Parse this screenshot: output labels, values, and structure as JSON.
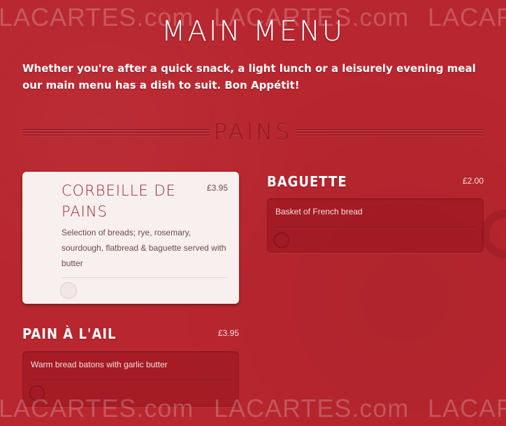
{
  "watermark": {
    "text": "LACARTES.com"
  },
  "page": {
    "title": "MAIN MENU",
    "intro": "Whether you're after a quick snack, a light lunch or a leisurely evening meal our main menu has a dish to suit. Bon Appétit!"
  },
  "section": {
    "title": "PAINS"
  },
  "items": [
    {
      "name": "CORBEILLE DE PAINS",
      "price": "£3.95",
      "description": "Selection of breads; rye, rosemary, sourdough, flatbread & baguette served with butter",
      "selected": true
    },
    {
      "name": "BAGUETTE",
      "price": "£2.00",
      "description": "Basket of French bread",
      "selected": false
    },
    {
      "name": "PAIN À L'AIL",
      "price": "£3.95",
      "description": "Warm bread batons with garlic butter",
      "selected": false
    }
  ],
  "colors": {
    "background": "#b8262f",
    "card": "#f8efef",
    "accent": "#9b2a33"
  }
}
